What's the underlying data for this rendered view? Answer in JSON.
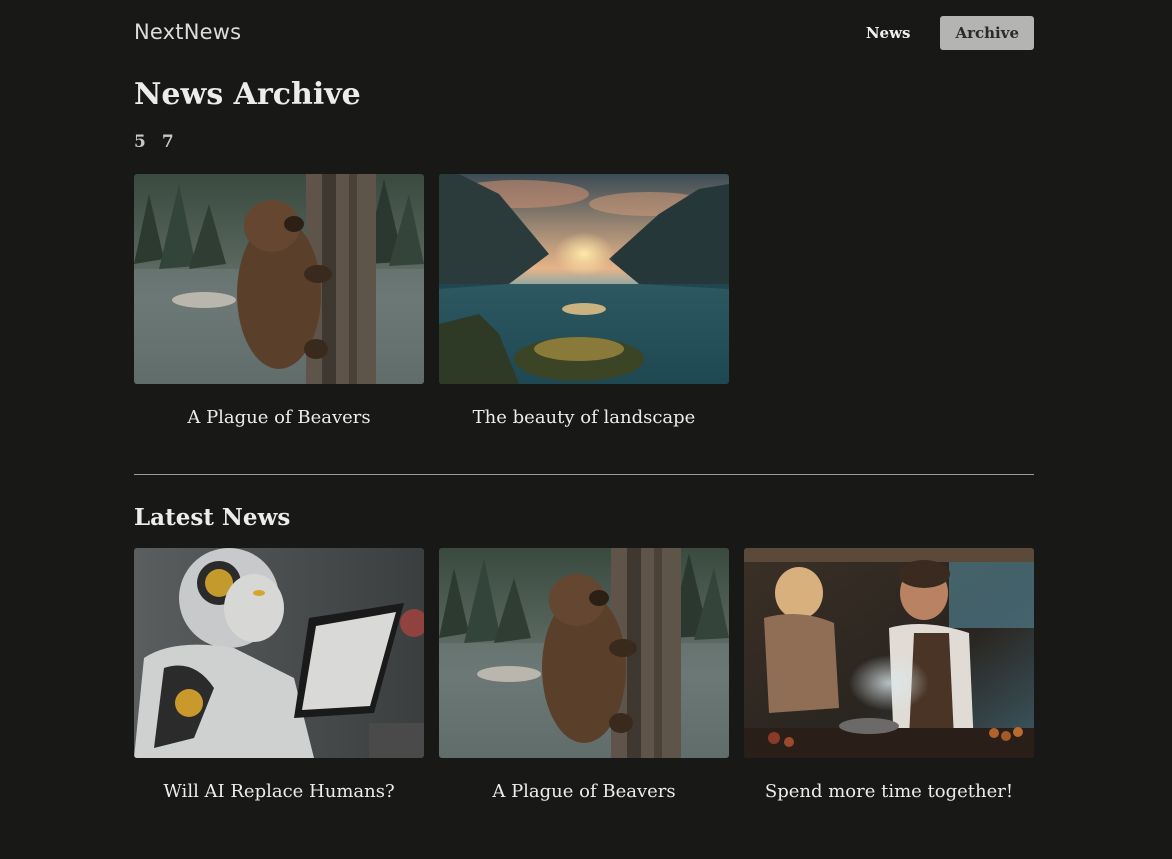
{
  "header": {
    "logo": "NextNews",
    "nav": [
      {
        "label": "News",
        "active": false
      },
      {
        "label": "Archive",
        "active": true
      }
    ]
  },
  "archive": {
    "title": "News Archive",
    "years": [
      "5",
      "7"
    ],
    "articles": [
      {
        "title": "A Plague of Beavers",
        "image": "beaver-photo"
      },
      {
        "title": "The beauty of landscape",
        "image": "mountain-lake-photo"
      }
    ]
  },
  "latest": {
    "title": "Latest News",
    "articles": [
      {
        "title": "Will AI Replace Humans?",
        "image": "robot-tablet-photo"
      },
      {
        "title": "A Plague of Beavers",
        "image": "beaver-photo"
      },
      {
        "title": "Spend more time together!",
        "image": "couple-cooking-photo"
      }
    ]
  },
  "colors": {
    "background": "#181817",
    "active_nav_bg": "#b4b4b2",
    "divider": "#9a9a9a"
  }
}
